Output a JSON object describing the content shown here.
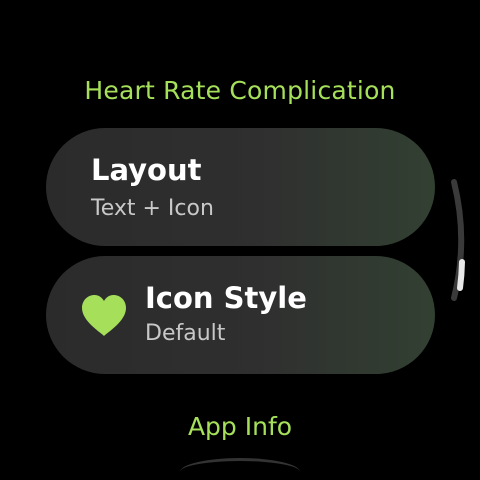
{
  "header": {
    "title": "Heart Rate Complication"
  },
  "items": [
    {
      "primary": "Layout",
      "secondary": "Text + Icon"
    },
    {
      "icon": "heart-icon",
      "primary": "Icon Style",
      "secondary": "Default"
    }
  ],
  "footer": {
    "app_info_label": "App Info"
  },
  "colors": {
    "accent": "#a6e05b",
    "chip_background": "#2f2f2f",
    "background": "#000000"
  }
}
